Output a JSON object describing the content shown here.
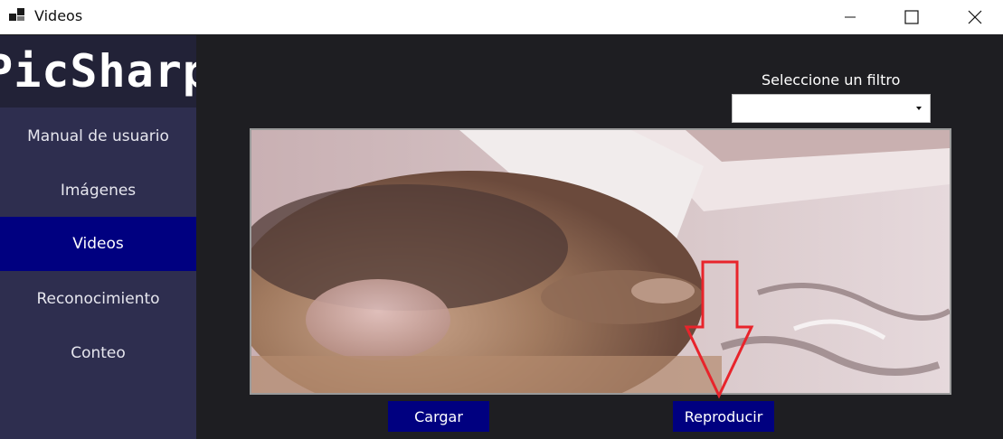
{
  "window": {
    "title": "Videos",
    "icons": {
      "app": "app-window-icon",
      "minimize": "minimize-icon",
      "maximize": "maximize-icon",
      "close": "close-icon"
    }
  },
  "sidebar": {
    "logo": "PicSharp",
    "items": [
      {
        "label": "Manual de usuario",
        "active": false
      },
      {
        "label": "Imágenes",
        "active": false
      },
      {
        "label": "Videos",
        "active": true
      },
      {
        "label": "Reconocimiento",
        "active": false
      },
      {
        "label": "Conteo",
        "active": false
      }
    ]
  },
  "main": {
    "filter": {
      "label": "Seleccione un filtro",
      "value": ""
    },
    "buttons": {
      "load": "Cargar",
      "play": "Reproducir"
    }
  },
  "colors": {
    "sidebar": "#2e2e4f",
    "logo_bg": "#222237",
    "active": "#000080",
    "background": "#1e1e22",
    "annotation": "#e8242b"
  }
}
